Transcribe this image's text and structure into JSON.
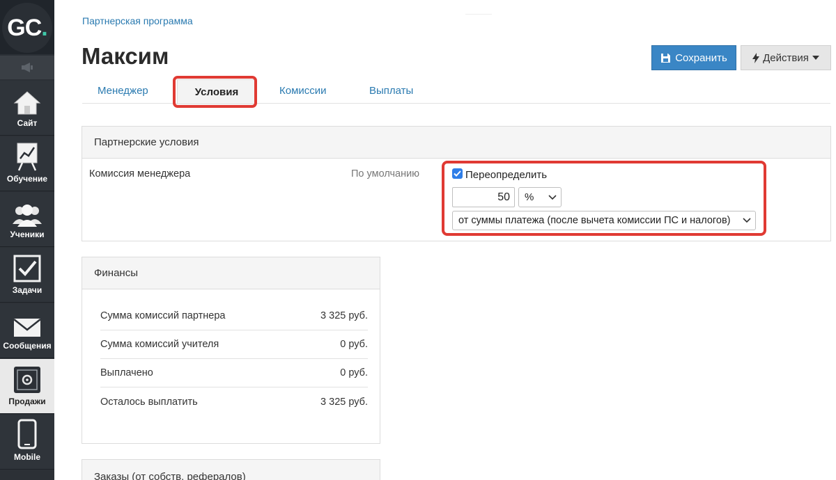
{
  "sidebar": {
    "logo": {
      "main": "GC",
      "dot": "."
    },
    "items": [
      {
        "label": "Сайт",
        "icon": "home-icon"
      },
      {
        "label": "Обучение",
        "icon": "chart-board-icon"
      },
      {
        "label": "Ученики",
        "icon": "users-icon"
      },
      {
        "label": "Задачи",
        "icon": "checkbox-icon"
      },
      {
        "label": "Сообщения",
        "icon": "envelope-icon"
      },
      {
        "label": "Продажи",
        "icon": "safe-icon"
      },
      {
        "label": "Mobile",
        "icon": "mobile-icon"
      }
    ]
  },
  "header": {
    "breadcrumb": "Партнерская программа",
    "title": "Максим",
    "save_label": "Сохранить",
    "actions_label": "Действия"
  },
  "tabs": [
    {
      "label": "Менеджер"
    },
    {
      "label": "Условия"
    },
    {
      "label": "Комиссии"
    },
    {
      "label": "Выплаты"
    }
  ],
  "terms": {
    "heading": "Партнерские условия",
    "row_label": "Комиссия менеджера",
    "default_label": "По умолчанию",
    "override_label": "Переопределить",
    "override_checked": true,
    "value": "50",
    "unit": "%",
    "base": "от суммы платежа (после вычета комиссии ПС и налогов)"
  },
  "finance": {
    "heading": "Финансы",
    "rows": [
      {
        "label": "Сумма комиссий партнера",
        "value": "3 325 руб."
      },
      {
        "label": "Сумма комиссий учителя",
        "value": "0 руб."
      },
      {
        "label": "Выплачено",
        "value": "0 руб."
      },
      {
        "label": "Осталось выплатить",
        "value": "3 325 руб."
      }
    ]
  },
  "orders": {
    "heading": "Заказы (от собств. рефералов)"
  },
  "colors": {
    "accent": "#3a86c5",
    "link": "#2a7ab0",
    "highlight": "#e03a33",
    "sidebar": "#2c3036",
    "logo_dot": "#3fc7a8"
  }
}
